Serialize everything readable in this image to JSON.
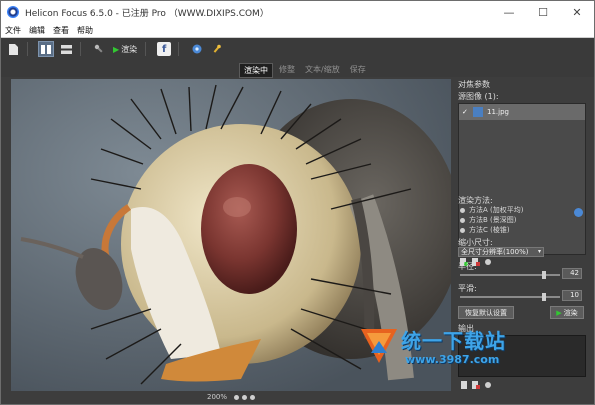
{
  "window": {
    "title": "Helicon Focus 6.5.0 - 已注册 Pro （WWW.DIXIPS.COM）",
    "controls": {
      "minimize": "—",
      "maximize": "☐",
      "close": "✕"
    }
  },
  "menu": {
    "items": [
      "文件",
      "编辑",
      "查看",
      "帮助"
    ]
  },
  "toolbar": {
    "render_label": "渲染",
    "facebook_label": "f"
  },
  "tabs": [
    {
      "label": "渲染中",
      "active": true
    },
    {
      "label": "修整",
      "active": false
    },
    {
      "label": "文本/缩放",
      "active": false
    },
    {
      "label": "保存",
      "active": false
    }
  ],
  "viewer": {
    "zoom": "200%"
  },
  "panel": {
    "section_title": "对焦参数",
    "source_label": "源图像 (1):",
    "source_files": [
      {
        "name": "11.jpg",
        "checked": true
      }
    ],
    "render_method_label": "渲染方法:",
    "methods": [
      {
        "label": "方法A (加权平均)",
        "selected": false
      },
      {
        "label": "方法B (景深图)",
        "selected": false
      },
      {
        "label": "方法C (棱锥)",
        "selected": false
      }
    ],
    "downscale_label": "缩小尺寸:",
    "downscale_value": "全尺寸分辨率(100%)",
    "radius_label": "半径:",
    "radius_value": "42",
    "radius_level": 0.85,
    "smoothing_label": "平滑:",
    "smoothing_value": "10",
    "smoothing_level": 0.85,
    "reset_button": "恢复默认设置",
    "render_button": "渲染",
    "output_label": "输出"
  },
  "watermark": {
    "text": "统一下载站",
    "url": "www.3987.com"
  },
  "colors": {
    "accent": "#5a6e86",
    "render_green": "#32c832",
    "watermark_blue": "#3ea4e8"
  }
}
